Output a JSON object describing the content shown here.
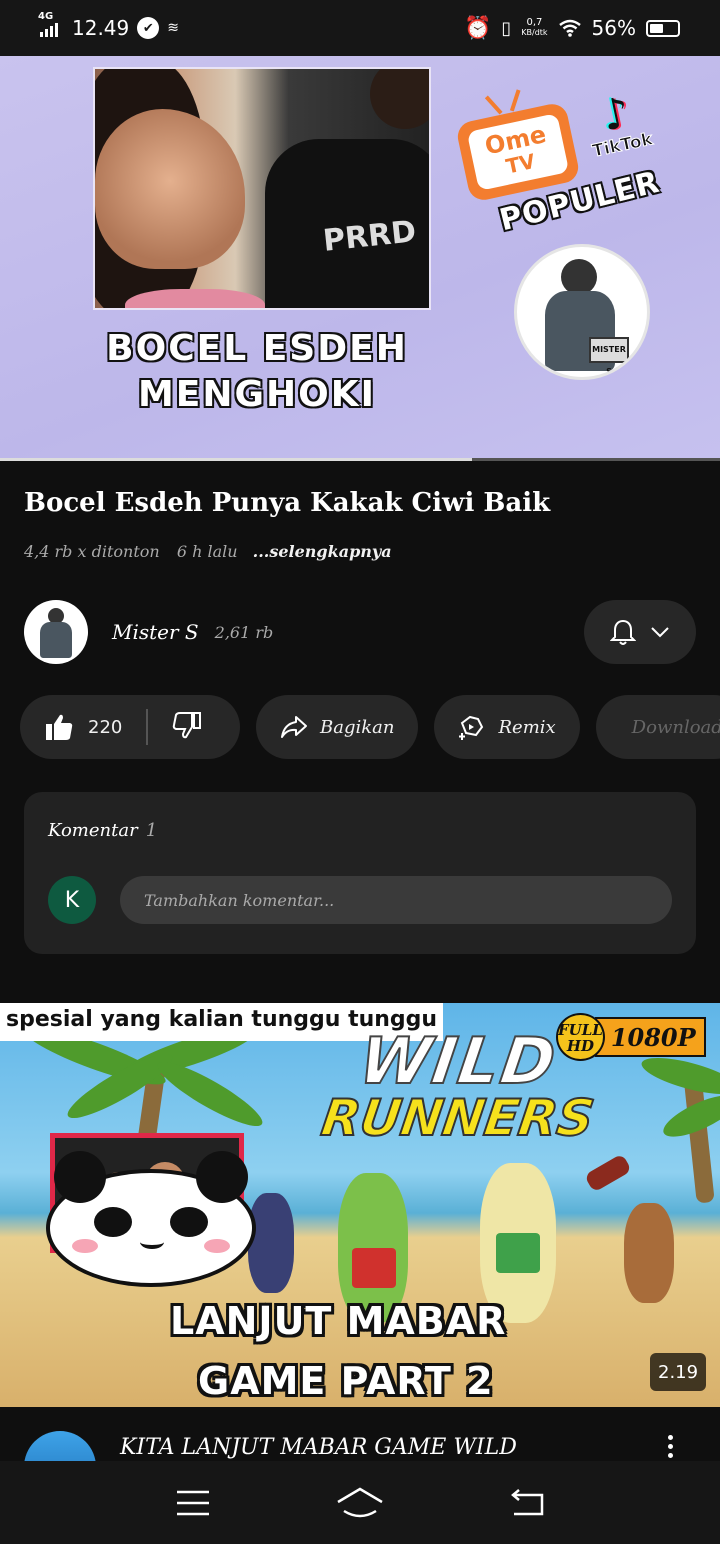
{
  "status_bar": {
    "network": "4G",
    "time": "12.49",
    "speed_value": "0,7",
    "speed_unit": "KB/dtk",
    "battery": "56%",
    "battery_level": 0.56
  },
  "hero": {
    "caption": "BOCEL ESDEH MENGHOKI",
    "shirt_text": "PRRD",
    "app_name": "Ome TV",
    "app_name_line1": "Ome",
    "app_name_line2": "TV",
    "tiktok": "TikTok",
    "label": "POPULER",
    "badge_text": "MISTER S",
    "progress": 0.655
  },
  "video": {
    "title": "Bocel Esdeh Punya Kakak Ciwi Baik",
    "views": "4,4 rb x ditonton",
    "age": "6 h lalu",
    "more": "...selengkapnya"
  },
  "channel": {
    "name": "Mister S",
    "subscribers": "2,61 rb",
    "bell_icon": "bell-icon"
  },
  "actions": {
    "likes": "220",
    "share": "Bagikan",
    "remix": "Remix",
    "download": "Download"
  },
  "comments": {
    "label": "Komentar",
    "count": "1",
    "avatar_letter": "K",
    "placeholder": "Tambahkan komentar..."
  },
  "next_video": {
    "banner": "spesial yang kalian tunggu tunggu",
    "game_title_1": "WILD",
    "game_title_2": "RUNNERS",
    "hd_label_1": "FULL",
    "hd_label_2": "HD",
    "resolution": "1080P",
    "caption_1": "LANJUT MABAR",
    "caption_2": "GAME PART 2",
    "duration": "2.19",
    "title": "KITA LANJUT MABAR GAME WILD"
  },
  "colors": {
    "background": "#0f0f0f",
    "surface": "#272727",
    "comment_avatar": "#0e5a40",
    "hero_bg": "#c4bef0"
  }
}
